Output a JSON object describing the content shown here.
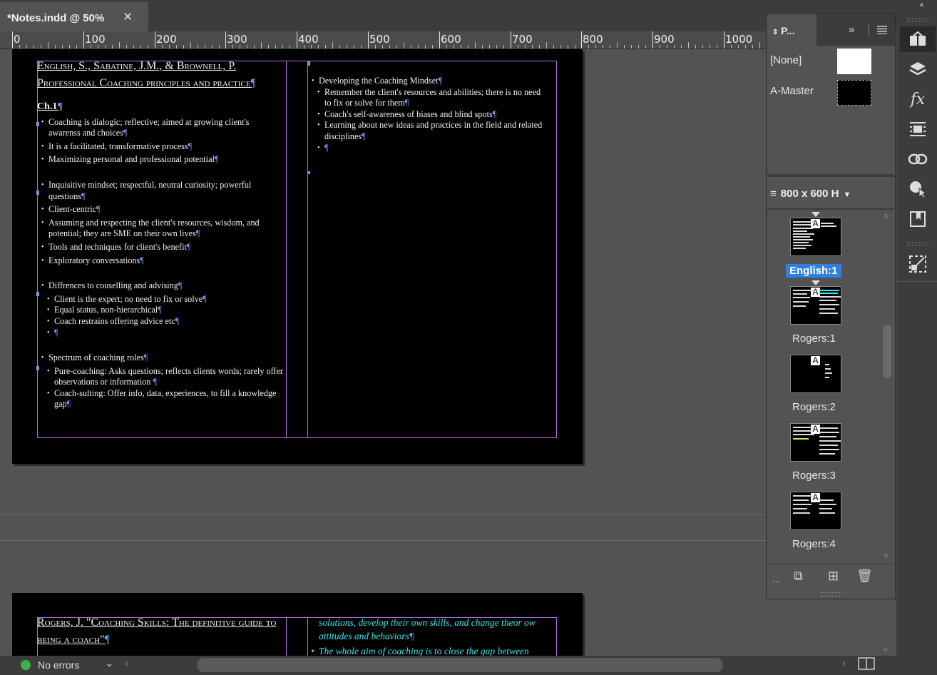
{
  "document_tab": {
    "title": "*Notes.indd @ 50%",
    "close": "✕"
  },
  "panel_collapse": "‹‹",
  "ruler": {
    "labels": [
      "0",
      "100",
      "200",
      "300",
      "400",
      "500",
      "600",
      "700",
      "800",
      "900",
      "1000"
    ]
  },
  "page1": {
    "heading": "English, S., Sabatine, J.M., & Brownell, P. Professional Coaching principles and practice",
    "chapter": "Ch.1",
    "left_groups": [
      [
        {
          "text": "Coaching is dialogic; reflective; aimed at growing client's awarenss and choices",
          "sub": false
        },
        {
          "text": "It is a facilitated, transformative process",
          "sub": false
        },
        {
          "text": "Maximizing personal and professional potential",
          "sub": false
        }
      ],
      [
        {
          "text": "Inquisitive mindset; respectful, neutral curiosity; powerful questions",
          "sub": false
        },
        {
          "text": "Client-centric",
          "sub": false
        },
        {
          "text": "Assuming and respecting the client's resources, wisdom, and potential; they are SME on their own lives",
          "sub": false
        },
        {
          "text": "Tools and techniques for client's benefit",
          "sub": false
        },
        {
          "text": "Exploratory conversations",
          "sub": false
        }
      ],
      [
        {
          "text": "Diffrences to couselling and advising",
          "sub": false
        },
        {
          "text": "Client is the expert; no need to fix or solve",
          "sub": true
        },
        {
          "text": "Equal status, non-hierarchical",
          "sub": true
        },
        {
          "text": "Coach restrains offering advice etc",
          "sub": true
        },
        {
          "text": "",
          "sub": true
        }
      ],
      [
        {
          "text": "Spectrum of coaching roles",
          "sub": false
        },
        {
          "text": "Pure-coaching: Asks questions; reflects clients words; rarely offer observations or information ",
          "sub": true
        },
        {
          "text": "Coach-sulting: Offer info, data, experiences, to fill a knowledge gap",
          "sub": true
        }
      ]
    ],
    "right_items": [
      {
        "text": "Developing the Coaching Mindset",
        "sub": false
      },
      {
        "text": "Remember the client's resources and abilities; there is no need to fix or solve for them",
        "sub": true
      },
      {
        "text": "Coach's self-awareness of biases and blind spots",
        "sub": true
      },
      {
        "text": "Learning about new ideas and practices in the field and related disciplines",
        "sub": true
      },
      {
        "text": "",
        "sub": true
      }
    ]
  },
  "page2": {
    "heading": "Rogers, J. \"Coaching Skills: The definitive guide to being a coach\"",
    "right_text_1": "solutions, develop their own skills, and change theor ow attitudes and behaviors",
    "right_text_2": "The whole aim of coaching is to close the gap between"
  },
  "pilcrow": "¶",
  "pages_panel": {
    "tab_label": "P...",
    "more": "»",
    "masters": [
      {
        "name": "[None]"
      },
      {
        "name": "A-Master"
      }
    ],
    "page_size": "800 x 600 H",
    "pages": [
      {
        "label": "English:1",
        "selected": true
      },
      {
        "label": "Rogers:1",
        "selected": false
      },
      {
        "label": "Rogers:2",
        "selected": false
      },
      {
        "label": "Rogers:3",
        "selected": false
      },
      {
        "label": "Rogers:4",
        "selected": false
      }
    ],
    "master_badge": "A",
    "footer_more": "..."
  },
  "status": {
    "text": "No errors",
    "color": "#3fb24a"
  },
  "colors": {
    "accent": "#3080e0",
    "margin_guide": "#b16ee6",
    "pilcrow": "#6f9cf2",
    "cyan_text": "#3ee6ee"
  }
}
